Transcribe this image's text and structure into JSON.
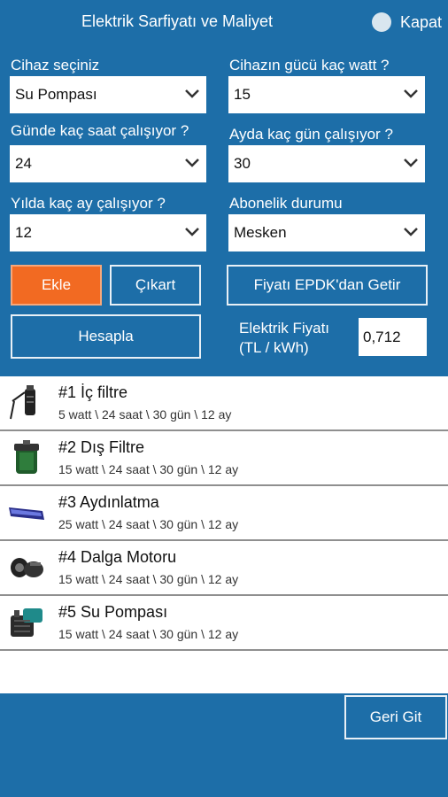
{
  "header": {
    "title": "Elektrik Sarfiyatı ve Maliyet",
    "close_label": "Kapat"
  },
  "form": {
    "device": {
      "label": "Cihaz seçiniz",
      "value": "Su Pompası"
    },
    "power": {
      "label": "Cihazın gücü kaç watt ?",
      "value": "15"
    },
    "hours": {
      "label": "Günde kaç saat çalışıyor ?",
      "value": "24"
    },
    "days": {
      "label": "Ayda kaç gün çalışıyor ?",
      "value": "30"
    },
    "months": {
      "label": "Yılda kaç ay çalışıyor ?",
      "value": "12"
    },
    "subscription": {
      "label": "Abonelik durumu",
      "value": "Mesken"
    }
  },
  "buttons": {
    "add": "Ekle",
    "remove": "Çıkart",
    "fetch_price": "Fiyatı EPDK'dan Getir",
    "calculate": "Hesapla",
    "back": "Geri Git"
  },
  "price": {
    "label_line1": "Elektrik Fiyatı",
    "label_line2": "(TL / kWh)",
    "value": "0,712"
  },
  "devices": [
    {
      "name": "#1 İç filtre",
      "detail": "5 watt \\ 24 saat \\ 30 gün \\ 12 ay",
      "icon": "inner-filter-icon"
    },
    {
      "name": "#2 Dış Filtre",
      "detail": "15 watt \\ 24 saat \\ 30 gün \\ 12 ay",
      "icon": "external-filter-icon"
    },
    {
      "name": "#3 Aydınlatma",
      "detail": "25 watt \\ 24 saat \\ 30 gün \\ 12 ay",
      "icon": "led-light-icon"
    },
    {
      "name": "#4 Dalga Motoru",
      "detail": "15 watt \\ 24 saat \\ 30 gün \\ 12 ay",
      "icon": "wave-maker-icon"
    },
    {
      "name": "#5 Su Pompası",
      "detail": "15 watt \\ 24 saat \\ 30 gün \\ 12 ay",
      "icon": "water-pump-icon"
    }
  ],
  "colors": {
    "background": "#1d6ea8",
    "accent": "#f26a22"
  }
}
